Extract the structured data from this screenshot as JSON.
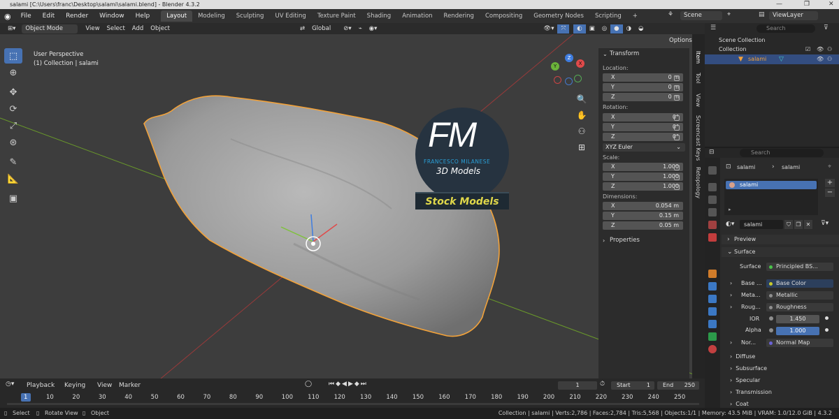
{
  "window": {
    "title": "salami [C:\\Users\\franc\\Desktop\\salami\\salami.blend] - Blender 4.3.2"
  },
  "menu": [
    "File",
    "Edit",
    "Render",
    "Window",
    "Help"
  ],
  "workspaces": [
    "Layout",
    "Modeling",
    "Sculpting",
    "UV Editing",
    "Texture Paint",
    "Shading",
    "Animation",
    "Rendering",
    "Compositing",
    "Geometry Nodes",
    "Scripting"
  ],
  "add_tab": "+",
  "scene": {
    "name": "Scene",
    "viewlayer": "ViewLayer"
  },
  "viewport_header": {
    "mode": "Object Mode",
    "view": "View",
    "select": "Select",
    "add": "Add",
    "object": "Object",
    "orientation": "Global",
    "options": "Options"
  },
  "overlay": {
    "perspective": "User Perspective",
    "collection": "(1) Collection | salami"
  },
  "gizmo": {
    "x": "X",
    "y": "Y",
    "z": "Z"
  },
  "watermark": {
    "letters": "FM",
    "line1": "FRANCESCO MILANESE",
    "line2": "3D Models",
    "banner": "Stock Models"
  },
  "npanel": {
    "transform": "Transform",
    "location_label": "Location:",
    "location": [
      {
        "axis": "X",
        "value": "0 m"
      },
      {
        "axis": "Y",
        "value": "0 m"
      },
      {
        "axis": "Z",
        "value": "0 m"
      }
    ],
    "rotation_label": "Rotation:",
    "rotation": [
      {
        "axis": "X",
        "value": "0°"
      },
      {
        "axis": "Y",
        "value": "0°"
      },
      {
        "axis": "Z",
        "value": "0°"
      }
    ],
    "rotation_mode": "XYZ Euler",
    "scale_label": "Scale:",
    "scale": [
      {
        "axis": "X",
        "value": "1.000"
      },
      {
        "axis": "Y",
        "value": "1.000"
      },
      {
        "axis": "Z",
        "value": "1.000"
      }
    ],
    "dimensions_label": "Dimensions:",
    "dimensions": [
      {
        "axis": "X",
        "value": "0.054 m"
      },
      {
        "axis": "Y",
        "value": "0.15 m"
      },
      {
        "axis": "Z",
        "value": "0.05 m"
      }
    ],
    "properties": "Properties",
    "tabs": [
      "Item",
      "Tool",
      "View",
      "Screencast Keys",
      "Retopology"
    ]
  },
  "outliner": {
    "search": "Search",
    "scene_collection": "Scene Collection",
    "collection": "Collection",
    "object": "salami"
  },
  "properties": {
    "search": "Search",
    "breadcrumb": [
      "salami",
      "salami"
    ],
    "slot": "salami",
    "material": "salami",
    "preview": "Preview",
    "surface_section": "Surface",
    "surface_label": "Surface",
    "surface_value": "Principled BS...",
    "inputs": [
      {
        "label": "Base ...",
        "value": "Base Color",
        "color": "#c7c92c"
      },
      {
        "label": "Meta...",
        "value": "Metallic",
        "color": "#8f8f8f"
      },
      {
        "label": "Roug...",
        "value": "Roughness",
        "color": "#8f8f8f"
      }
    ],
    "ior_label": "IOR",
    "ior": "1.450",
    "alpha_label": "Alpha",
    "alpha": "1.000",
    "normal_label": "Nor...",
    "normal_value": "Normal Map",
    "sections": [
      "Diffuse",
      "Subsurface",
      "Specular",
      "Transmission",
      "Coat"
    ]
  },
  "timeline": {
    "playback": "Playback",
    "keying": "Keying",
    "view": "View",
    "marker": "Marker",
    "current_frame": "1",
    "start_label": "Start",
    "start": "1",
    "end_label": "End",
    "end": "250",
    "ticks": [
      "1",
      "10",
      "20",
      "30",
      "40",
      "50",
      "60",
      "70",
      "80",
      "90",
      "100",
      "110",
      "120",
      "130",
      "140",
      "150",
      "160",
      "170",
      "180",
      "190",
      "200",
      "210",
      "220",
      "230",
      "240",
      "250"
    ]
  },
  "status": {
    "select": "Select",
    "rotate": "Rotate View",
    "object": "Object",
    "stats": "Collection | salami | Verts:2,786 | Faces:2,784 | Tris:5,568 | Objects:1/1 | Memory: 43.5 MiB | VRAM: 1.0/12.0 GiB | 4.3.2"
  },
  "colors": {
    "accent": "#4772b3",
    "selection": "#f2a23a",
    "bg": "#3d3d3d"
  }
}
